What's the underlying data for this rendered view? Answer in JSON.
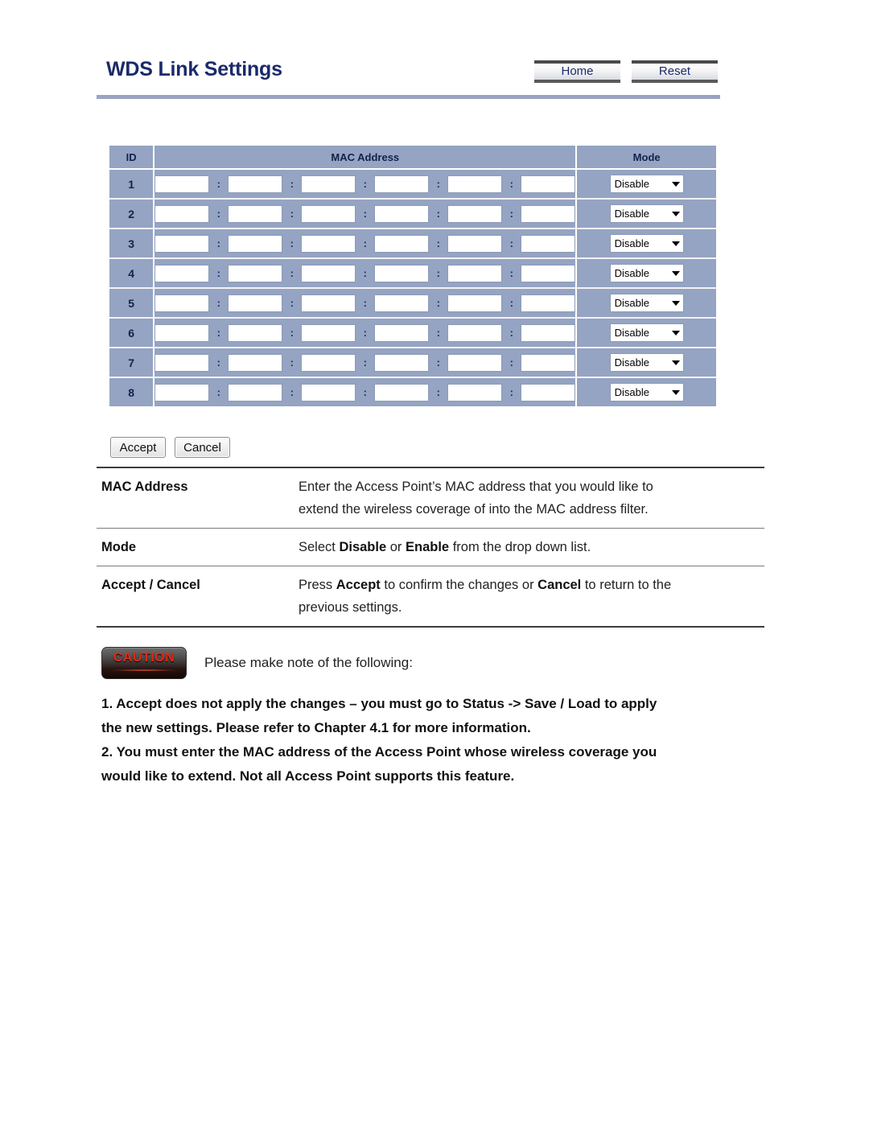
{
  "header": {
    "title": "WDS Link Settings",
    "buttons": [
      {
        "label": "Home",
        "name": "home-button"
      },
      {
        "label": "Reset",
        "name": "reset-button"
      }
    ]
  },
  "wds_table": {
    "columns": [
      "ID",
      "MAC Address",
      "Mode"
    ],
    "mac_separator": ":",
    "mac_octet_count": 6,
    "rows": [
      {
        "id": "1",
        "mac": [
          "",
          "",
          "",
          "",
          "",
          ""
        ],
        "mode": "Disable"
      },
      {
        "id": "2",
        "mac": [
          "",
          "",
          "",
          "",
          "",
          ""
        ],
        "mode": "Disable"
      },
      {
        "id": "3",
        "mac": [
          "",
          "",
          "",
          "",
          "",
          ""
        ],
        "mode": "Disable"
      },
      {
        "id": "4",
        "mac": [
          "",
          "",
          "",
          "",
          "",
          ""
        ],
        "mode": "Disable"
      },
      {
        "id": "5",
        "mac": [
          "",
          "",
          "",
          "",
          "",
          ""
        ],
        "mode": "Disable"
      },
      {
        "id": "6",
        "mac": [
          "",
          "",
          "",
          "",
          "",
          ""
        ],
        "mode": "Disable"
      },
      {
        "id": "7",
        "mac": [
          "",
          "",
          "",
          "",
          "",
          ""
        ],
        "mode": "Disable"
      },
      {
        "id": "8",
        "mac": [
          "",
          "",
          "",
          "",
          "",
          ""
        ],
        "mode": "Disable"
      }
    ],
    "mode_options": [
      "Disable",
      "Enable"
    ]
  },
  "actions": {
    "accept_label": "Accept",
    "cancel_label": "Cancel"
  },
  "descriptions": [
    {
      "term": "MAC Address",
      "lines": [
        "Enter the Access Point’s MAC address that you would like to",
        "extend the wireless coverage of into the MAC address filter."
      ]
    },
    {
      "term": "Mode",
      "lines": [
        "Select <b>Disable</b> or <b>Enable</b> from the drop down list."
      ]
    },
    {
      "term": "Accept / Cancel",
      "lines": [
        "Press <b>Accept</b> to confirm the changes or <b>Cancel</b> to return to the",
        "previous settings."
      ]
    }
  ],
  "caution": {
    "badge_label": "CAUTION",
    "note": "Please make note of the following:",
    "items": [
      "1. Accept does not apply the changes – you must go to Status -> Save / Load to apply",
      "the new settings. Please refer to Chapter 4.1 for more information.",
      "2. You must enter the MAC address of the Access Point whose wireless coverage you",
      "would like to extend. Not all Access Point supports this feature."
    ]
  },
  "colors": {
    "title": "#1b2a6b",
    "table_cell": "#94a4c2",
    "rule": "#9aa4c0",
    "caution_text": "#e02b18"
  }
}
